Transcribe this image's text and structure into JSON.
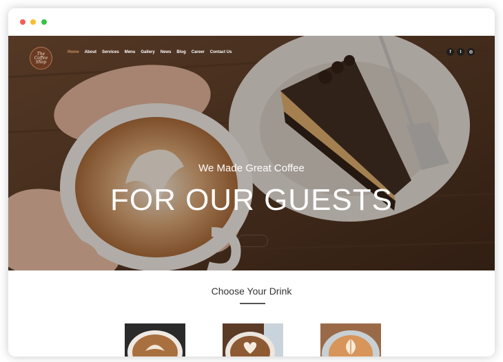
{
  "browser": {
    "dots": [
      "close",
      "minimize",
      "maximize"
    ]
  },
  "logo": {
    "text": "The\nCoffee\nShop"
  },
  "nav": {
    "items": [
      "Home",
      "About",
      "Services",
      "Menu",
      "Gallery",
      "News",
      "Blog",
      "Career",
      "Contact Us"
    ],
    "active": "Home"
  },
  "socials": [
    {
      "icon": "facebook-icon",
      "glyph": "f"
    },
    {
      "icon": "twitter-icon",
      "glyph": "t"
    },
    {
      "icon": "instagram-icon",
      "glyph": "◎"
    }
  ],
  "hero": {
    "subtitle": "We Made Great Coffee",
    "title": "FOR OUR GUESTS"
  },
  "section": {
    "title": "Choose Your Drink"
  },
  "cards": [
    {
      "image": "latte-art-cup"
    },
    {
      "image": "heart-latte-cup"
    },
    {
      "image": "rosetta-latte-cup"
    }
  ],
  "colors": {
    "accent": "#c8945f",
    "hero_tint": "#4a3324",
    "heading": "#333333"
  }
}
